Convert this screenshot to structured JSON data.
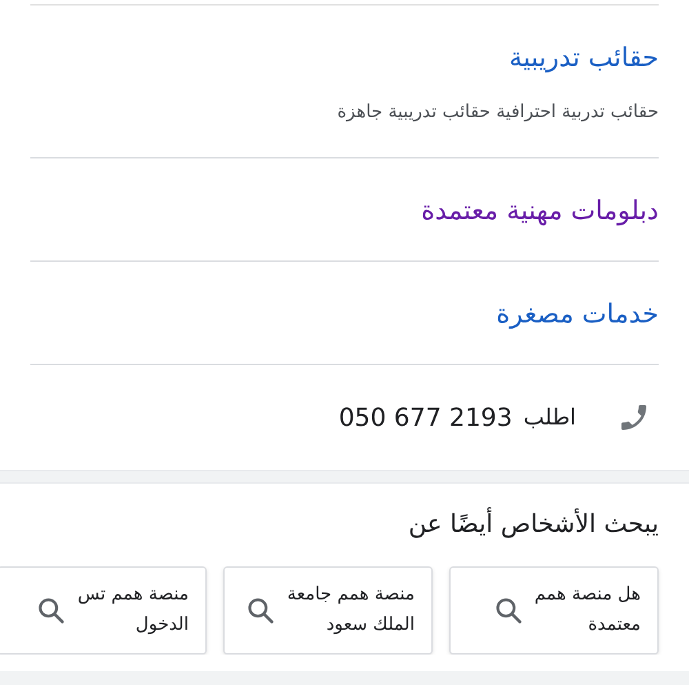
{
  "sitelinks": [
    {
      "title": "حقائب تدريبية",
      "visited": false,
      "description": "حقائب تدربية احترافية حقائب تدريبية جاهزة"
    },
    {
      "title": "دبلومات مهنية معتمدة",
      "visited": true
    },
    {
      "title": "خدمات مصغرة",
      "visited": false
    }
  ],
  "call": {
    "label": "اطلب",
    "number": "050 677 2193"
  },
  "related": {
    "heading": "يبحث الأشخاص أيضًا عن",
    "items": [
      {
        "lines": [
          "هل منصة همم",
          "معتمدة"
        ]
      },
      {
        "lines": [
          "منصة همم جامعة",
          "الملك سعود"
        ]
      },
      {
        "lines": [
          "منصة همم تس",
          "الدخول"
        ]
      }
    ]
  }
}
